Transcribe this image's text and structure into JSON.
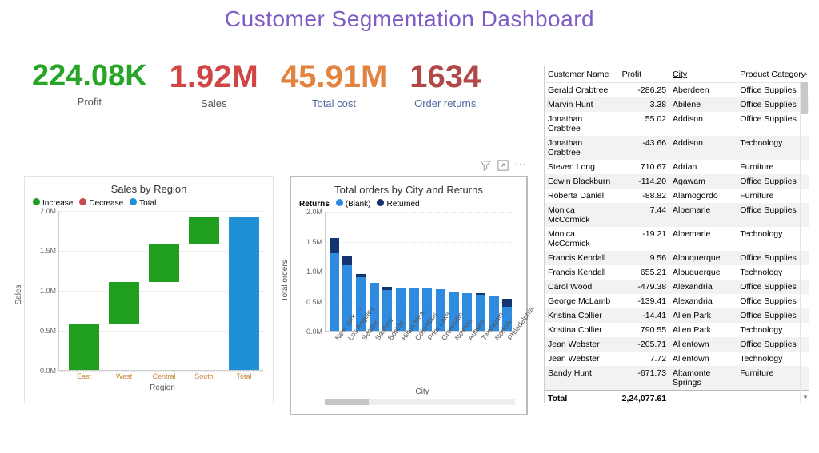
{
  "title": "Customer Segmentation Dashboard",
  "kpi": {
    "profit": {
      "value": "224.08K",
      "label": "Profit"
    },
    "sales": {
      "value": "1.92M",
      "label": "Sales"
    },
    "totalcost": {
      "value": "45.91M",
      "label": "Total cost"
    },
    "returns": {
      "value": "1634",
      "label": "Order returns"
    }
  },
  "table": {
    "headers": [
      "Customer Name",
      "Profit",
      "City",
      "Product Category"
    ],
    "sorted_col": "City",
    "rows": [
      {
        "name": "Gerald Crabtree",
        "profit": "-286.25",
        "city": "Aberdeen",
        "cat": "Office Supplies"
      },
      {
        "name": "Marvin Hunt",
        "profit": "3.38",
        "city": "Abilene",
        "cat": "Office Supplies"
      },
      {
        "name": "Jonathan Crabtree",
        "profit": "55.02",
        "city": "Addison",
        "cat": "Office Supplies"
      },
      {
        "name": "Jonathan Crabtree",
        "profit": "-43.66",
        "city": "Addison",
        "cat": "Technology"
      },
      {
        "name": "Steven Long",
        "profit": "710.67",
        "city": "Adrian",
        "cat": "Furniture"
      },
      {
        "name": "Edwin Blackburn",
        "profit": "-114.20",
        "city": "Agawam",
        "cat": "Office Supplies"
      },
      {
        "name": "Roberta Daniel",
        "profit": "-88.82",
        "city": "Alamogordo",
        "cat": "Furniture"
      },
      {
        "name": "Monica McCormick",
        "profit": "7.44",
        "city": "Albemarle",
        "cat": "Office Supplies"
      },
      {
        "name": "Monica McCormick",
        "profit": "-19.21",
        "city": "Albemarle",
        "cat": "Technology"
      },
      {
        "name": "Francis Kendall",
        "profit": "9.56",
        "city": "Albuquerque",
        "cat": "Office Supplies"
      },
      {
        "name": "Francis Kendall",
        "profit": "655.21",
        "city": "Albuquerque",
        "cat": "Technology"
      },
      {
        "name": "Carol Wood",
        "profit": "-479.38",
        "city": "Alexandria",
        "cat": "Office Supplies"
      },
      {
        "name": "George McLamb",
        "profit": "-139.41",
        "city": "Alexandria",
        "cat": "Office Supplies"
      },
      {
        "name": "Kristina Collier",
        "profit": "-14.41",
        "city": "Allen Park",
        "cat": "Office Supplies"
      },
      {
        "name": "Kristina Collier",
        "profit": "790.55",
        "city": "Allen Park",
        "cat": "Technology"
      },
      {
        "name": "Jean Webster",
        "profit": "-205.71",
        "city": "Allentown",
        "cat": "Office Supplies"
      },
      {
        "name": "Jean Webster",
        "profit": "7.72",
        "city": "Allentown",
        "cat": "Technology"
      },
      {
        "name": "Sandy Hunt",
        "profit": "-671.73",
        "city": "Altamonte Springs",
        "cat": "Furniture"
      }
    ],
    "total_label": "Total",
    "total_value": "2,24,077.61"
  },
  "chart_data": [
    {
      "id": "sales_by_region",
      "type": "waterfall",
      "title": "Sales by Region",
      "xlabel": "Region",
      "ylabel": "Sales",
      "ylim": [
        0,
        2000000
      ],
      "yticks": [
        "0.0M",
        "0.5M",
        "1.0M",
        "1.5M",
        "2.0M"
      ],
      "legend": [
        {
          "name": "Increase",
          "color": "#1f9e1f"
        },
        {
          "name": "Decrease",
          "color": "#c94a4a"
        },
        {
          "name": "Total",
          "color": "#1f8fd6"
        }
      ],
      "bars": [
        {
          "label": "East",
          "start": 0,
          "end": 580000,
          "kind": "increase"
        },
        {
          "label": "West",
          "start": 580000,
          "end": 1100000,
          "kind": "increase"
        },
        {
          "label": "Central",
          "start": 1100000,
          "end": 1570000,
          "kind": "increase"
        },
        {
          "label": "South",
          "start": 1570000,
          "end": 1920000,
          "kind": "increase"
        },
        {
          "label": "Total",
          "start": 0,
          "end": 1920000,
          "kind": "total"
        }
      ]
    },
    {
      "id": "orders_by_city",
      "type": "bar_stacked",
      "title": "Total orders by City and Returns",
      "xlabel": "City",
      "ylabel": "Total orders",
      "ylim": [
        0,
        2000000
      ],
      "yticks": [
        "0.0M",
        "0.5M",
        "1.0M",
        "1.5M",
        "2.0M"
      ],
      "legend_title": "Returns",
      "series": [
        {
          "name": "(Blank)",
          "color": "#2e8be0"
        },
        {
          "name": "Returned",
          "color": "#14356f"
        }
      ],
      "categories": [
        "New York …",
        "Los Angeles",
        "Seattle",
        "Sanford",
        "Boston",
        "Hilton Hea…",
        "Columbus",
        "Prior Lake",
        "Greenville",
        "Newton",
        "Auburn",
        "Twentynin…",
        "Norfolk",
        "Philadelphia"
      ],
      "data": [
        {
          "blank": 1300000,
          "returned": 250000
        },
        {
          "blank": 1100000,
          "returned": 150000
        },
        {
          "blank": 900000,
          "returned": 50000
        },
        {
          "blank": 800000,
          "returned": 0
        },
        {
          "blank": 680000,
          "returned": 60000
        },
        {
          "blank": 720000,
          "returned": 0
        },
        {
          "blank": 720000,
          "returned": 0
        },
        {
          "blank": 720000,
          "returned": 0
        },
        {
          "blank": 700000,
          "returned": 0
        },
        {
          "blank": 650000,
          "returned": 0
        },
        {
          "blank": 630000,
          "returned": 0
        },
        {
          "blank": 600000,
          "returned": 30000
        },
        {
          "blank": 580000,
          "returned": 0
        },
        {
          "blank": 400000,
          "returned": 130000
        }
      ]
    }
  ],
  "toolbar": {
    "filter": "Filter",
    "focus": "Focus mode",
    "more": "More options"
  }
}
